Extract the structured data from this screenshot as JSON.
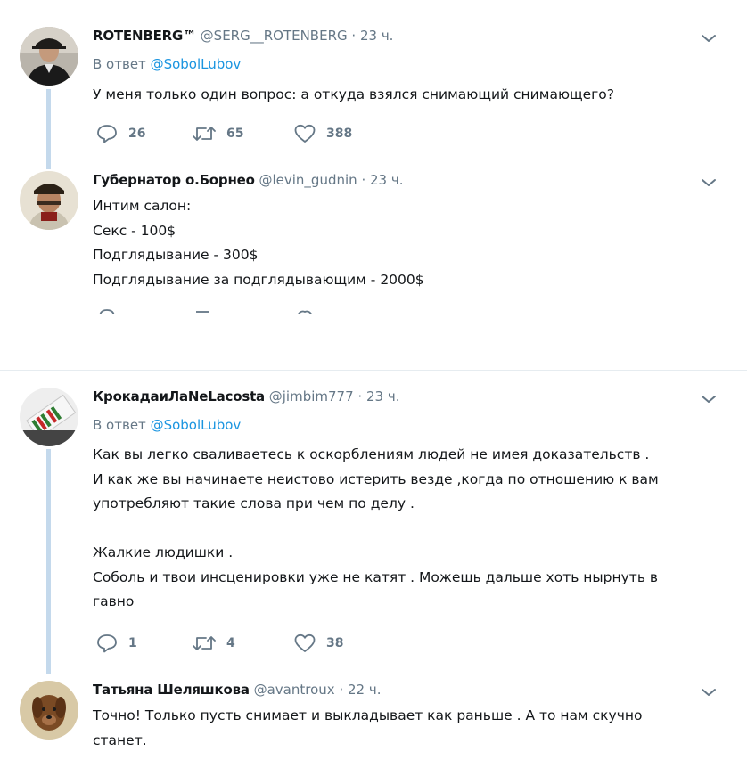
{
  "tweets": [
    {
      "name": "ROTENBERG™",
      "handle": "@SERG__ROTENBERG",
      "time": "23 ч.",
      "reply_prefix": "В ответ",
      "reply_handle": "@SobolLubov",
      "lines": [
        "У меня только один вопрос: а откуда взялся снимающий снимающего?"
      ],
      "replies": "26",
      "retweets": "65",
      "likes": "388"
    },
    {
      "name": "Губернатор о.Борнео",
      "handle": "@levin_gudnin",
      "time": "23 ч.",
      "lines": [
        "Интим салон:",
        "Секс - 100$",
        "Подглядывание - 300$",
        "Подглядывание за подглядывающим - 2000$"
      ]
    },
    {
      "name": "КрокадаиЛаNeLacosta",
      "handle": "@jimbim777",
      "time": "23 ч.",
      "reply_prefix": "В ответ",
      "reply_handle": "@SobolLubov",
      "lines": [
        "Как вы легко сваливаетесь к оскорблениям людей  не имея доказательств .",
        "И как же вы начинаете неистово истерить везде ,когда по отношению к вам",
        "употребляют такие слова при чем по делу .",
        "",
        "Жалкие людишки .",
        "Соболь и твои инсценировки уже не катят . Можешь дальше хоть нырнуть в",
        "гавно"
      ],
      "replies": "1",
      "retweets": "4",
      "likes": "38"
    },
    {
      "name": "Татьяна Шеляшкова",
      "handle": "@avantroux",
      "time": "22 ч.",
      "lines": [
        "Точно! Только пусть снимает и выкладывает как раньше . А то нам скучно",
        "станет."
      ]
    }
  ],
  "colors": {
    "link": "#1b95e0",
    "muted": "#657786",
    "thread_line": "#c4d9ec",
    "separator": "#e6ecf0"
  },
  "icons": [
    "reply-icon",
    "retweet-icon",
    "like-icon",
    "chevron-down-icon"
  ]
}
